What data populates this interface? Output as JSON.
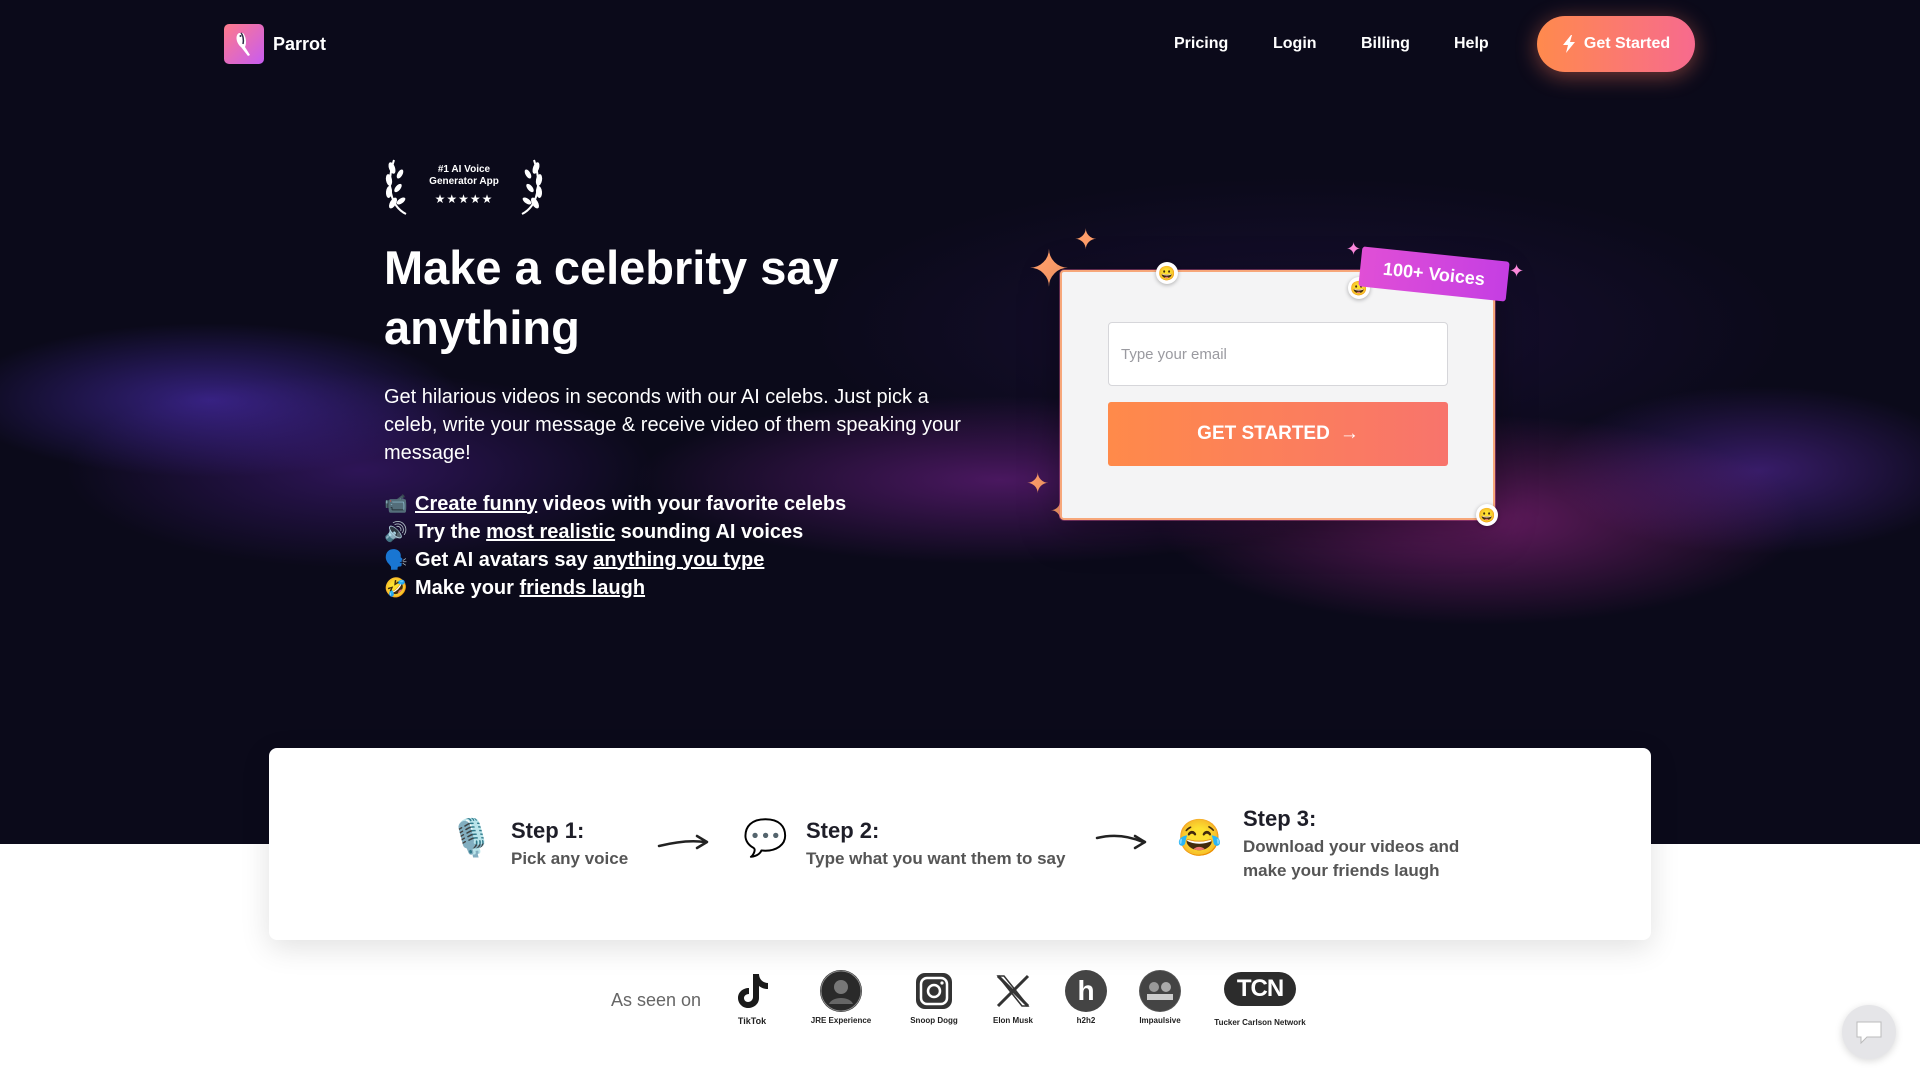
{
  "brand": {
    "name": "Parrot",
    "accent": "#ff8a4d",
    "accent_pink": "#f76a8e",
    "badge_purple": "#d247dc"
  },
  "nav": {
    "links": [
      "Pricing",
      "Login",
      "Billing",
      "Help"
    ],
    "cta_label": "Get Started"
  },
  "hero": {
    "award": {
      "line1": "#1 AI Voice",
      "line2": "Generator App",
      "stars": "★★★★★"
    },
    "title": "Make a celebrity say anything",
    "subtitle": "Get hilarious videos in seconds with our AI celebs. Just pick a celeb, write your message & receive video of them speaking your message!",
    "bullets": [
      {
        "icon": "clapper-icon",
        "emoji": "📹",
        "before": "",
        "link": "Create funny",
        "after": " videos with your favorite celebs"
      },
      {
        "icon": "speaker-icon",
        "emoji": "🔊",
        "before": "Try the ",
        "link": "most realistic",
        "after": " sounding AI voices"
      },
      {
        "icon": "speaking-head-icon",
        "emoji": "🗣️",
        "before": "Get AI avatars say ",
        "link": "anything you type",
        "after": ""
      },
      {
        "icon": "rofl-icon",
        "emoji": "🤣",
        "before": "Make your ",
        "link": "friends laugh",
        "after": ""
      }
    ]
  },
  "signup": {
    "email_placeholder": "Type your email",
    "email_value": "",
    "cta_label": "GET STARTED",
    "cta_arrow": "→",
    "badge": "100+ Voices"
  },
  "steps": [
    {
      "icon": "microphone-icon",
      "emoji": "🎙️",
      "title": "Step 1:",
      "desc": "Pick any voice"
    },
    {
      "icon": "speech-bubble-icon",
      "emoji": "💬",
      "title": "Step 2:",
      "desc": "Type what you want them to say"
    },
    {
      "icon": "laughing-icon",
      "emoji": "😂",
      "title": "Step 3:",
      "desc": "Download your videos and make your friends laugh"
    }
  ],
  "seen_on": {
    "label": "As seen on",
    "logos": [
      {
        "icon": "tiktok-icon",
        "caption": "TikTok"
      },
      {
        "icon": "jre-icon",
        "caption": "JRE Experience"
      },
      {
        "icon": "instagram-icon",
        "caption": "Snoop Dogg"
      },
      {
        "icon": "x-icon",
        "caption": "Elon Musk"
      },
      {
        "icon": "h2h2-icon",
        "caption": "h2h2"
      },
      {
        "icon": "impaulsive-icon",
        "caption": "Impaulsive"
      },
      {
        "icon": "tcn-icon",
        "caption": "Tucker Carlson Network",
        "mark": "TCN"
      }
    ]
  },
  "chat": {
    "icon": "chat-icon"
  }
}
